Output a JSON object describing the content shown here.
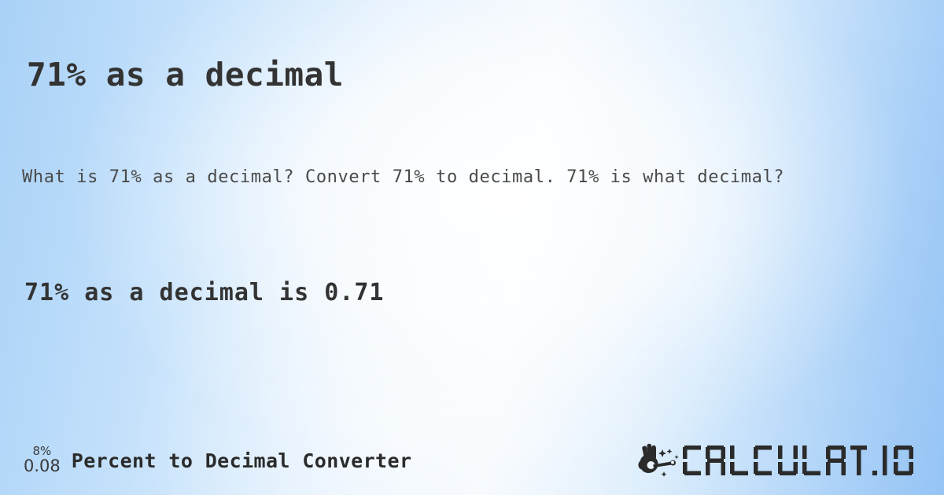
{
  "page": {
    "title": "71% as a decimal",
    "description": "What is 71% as a decimal? Convert 71% to decimal. 71% is what decimal?",
    "answer": "71% as a decimal is 0.71"
  },
  "values": {
    "percent": "71%",
    "decimal": "0.71"
  },
  "footer": {
    "icon_numerator": "8%",
    "icon_denominator": "0.08",
    "tool_name": "Percent to Decimal Converter",
    "logo_text": "CALCULAT.IO",
    "logo_icon": "hand-magic-wand-icon"
  },
  "colors": {
    "title_text": "#333333",
    "body_text": "#4a4a4a",
    "answer_text": "#333333",
    "footer_text": "#2b2b2b",
    "logo_text": "#2b2b2b",
    "background_light": "#f5faff",
    "background_mid": "#cbe3fb",
    "background_deep": "#95c4f5"
  }
}
